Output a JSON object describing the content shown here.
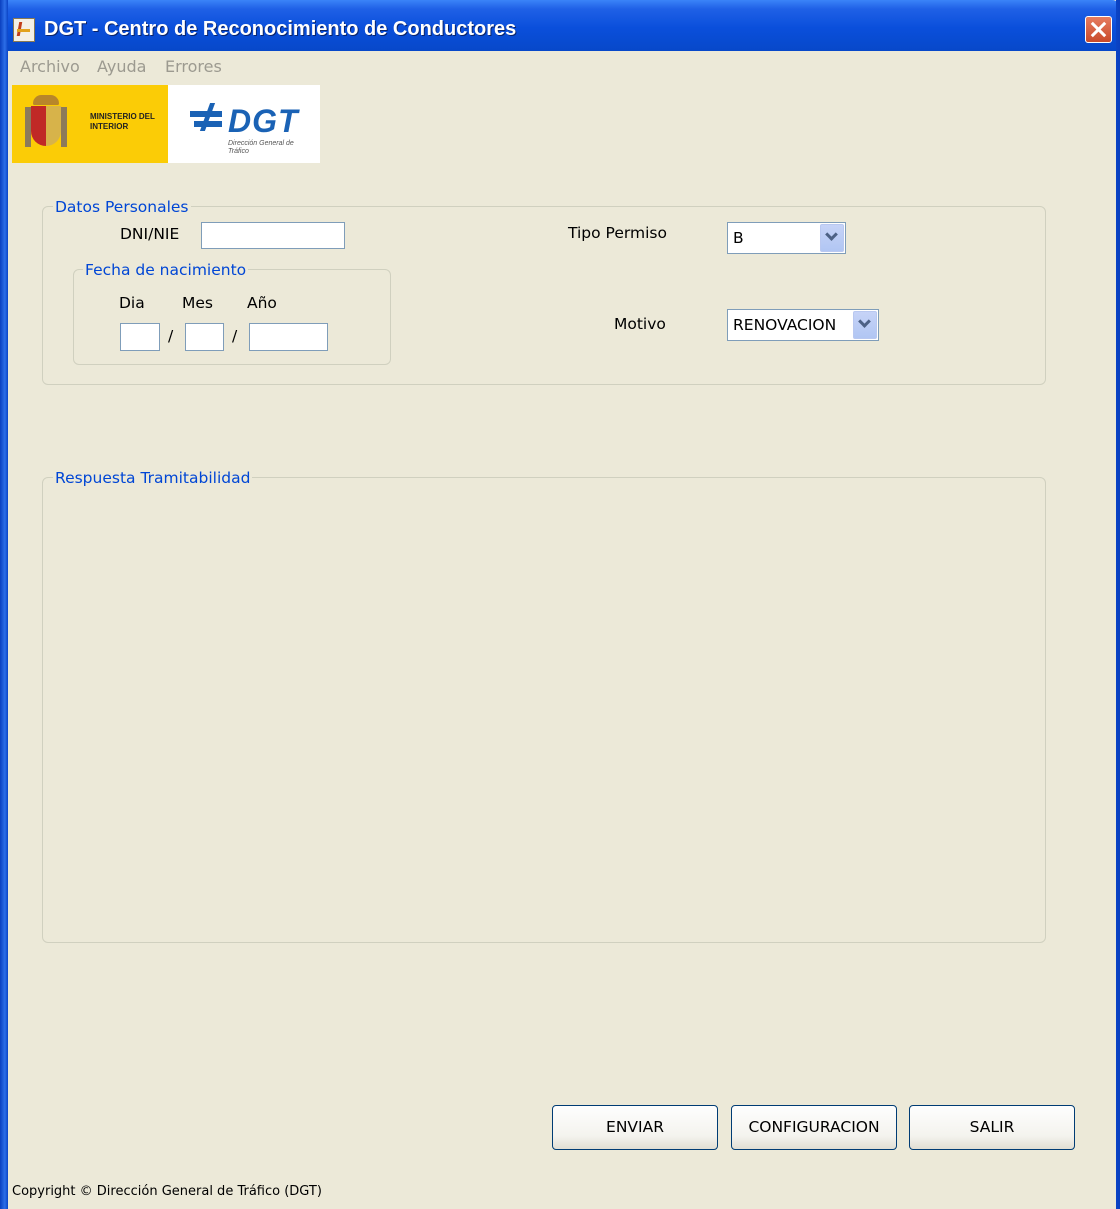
{
  "window": {
    "title": "DGT - Centro de Reconocimiento de Conductores"
  },
  "menu": [
    "Archivo",
    "Ayuda",
    "Errores"
  ],
  "logos": {
    "ministry_text": "MINISTERIO DEL INTERIOR",
    "dgt_text": "DGT",
    "dgt_sub": "Dirección General de Tráfico"
  },
  "datos_personales": {
    "legend": "Datos Personales",
    "dni_label": "DNI/NIE",
    "dni_value": "",
    "fecha_legend": "Fecha de nacimiento",
    "dia_label": "Dia",
    "mes_label": "Mes",
    "anio_label": "Año",
    "separator": "/",
    "tipo_permiso_label": "Tipo Permiso",
    "tipo_permiso_value": "B",
    "motivo_label": "Motivo",
    "motivo_value": "RENOVACION"
  },
  "respuesta": {
    "legend": "Respuesta Tramitabilidad"
  },
  "buttons": {
    "enviar": "ENVIAR",
    "configuracion": "CONFIGURACION",
    "salir": "SALIR"
  },
  "footer": {
    "copyright": "Copyright © Dirección General de Tráfico (DGT)"
  }
}
